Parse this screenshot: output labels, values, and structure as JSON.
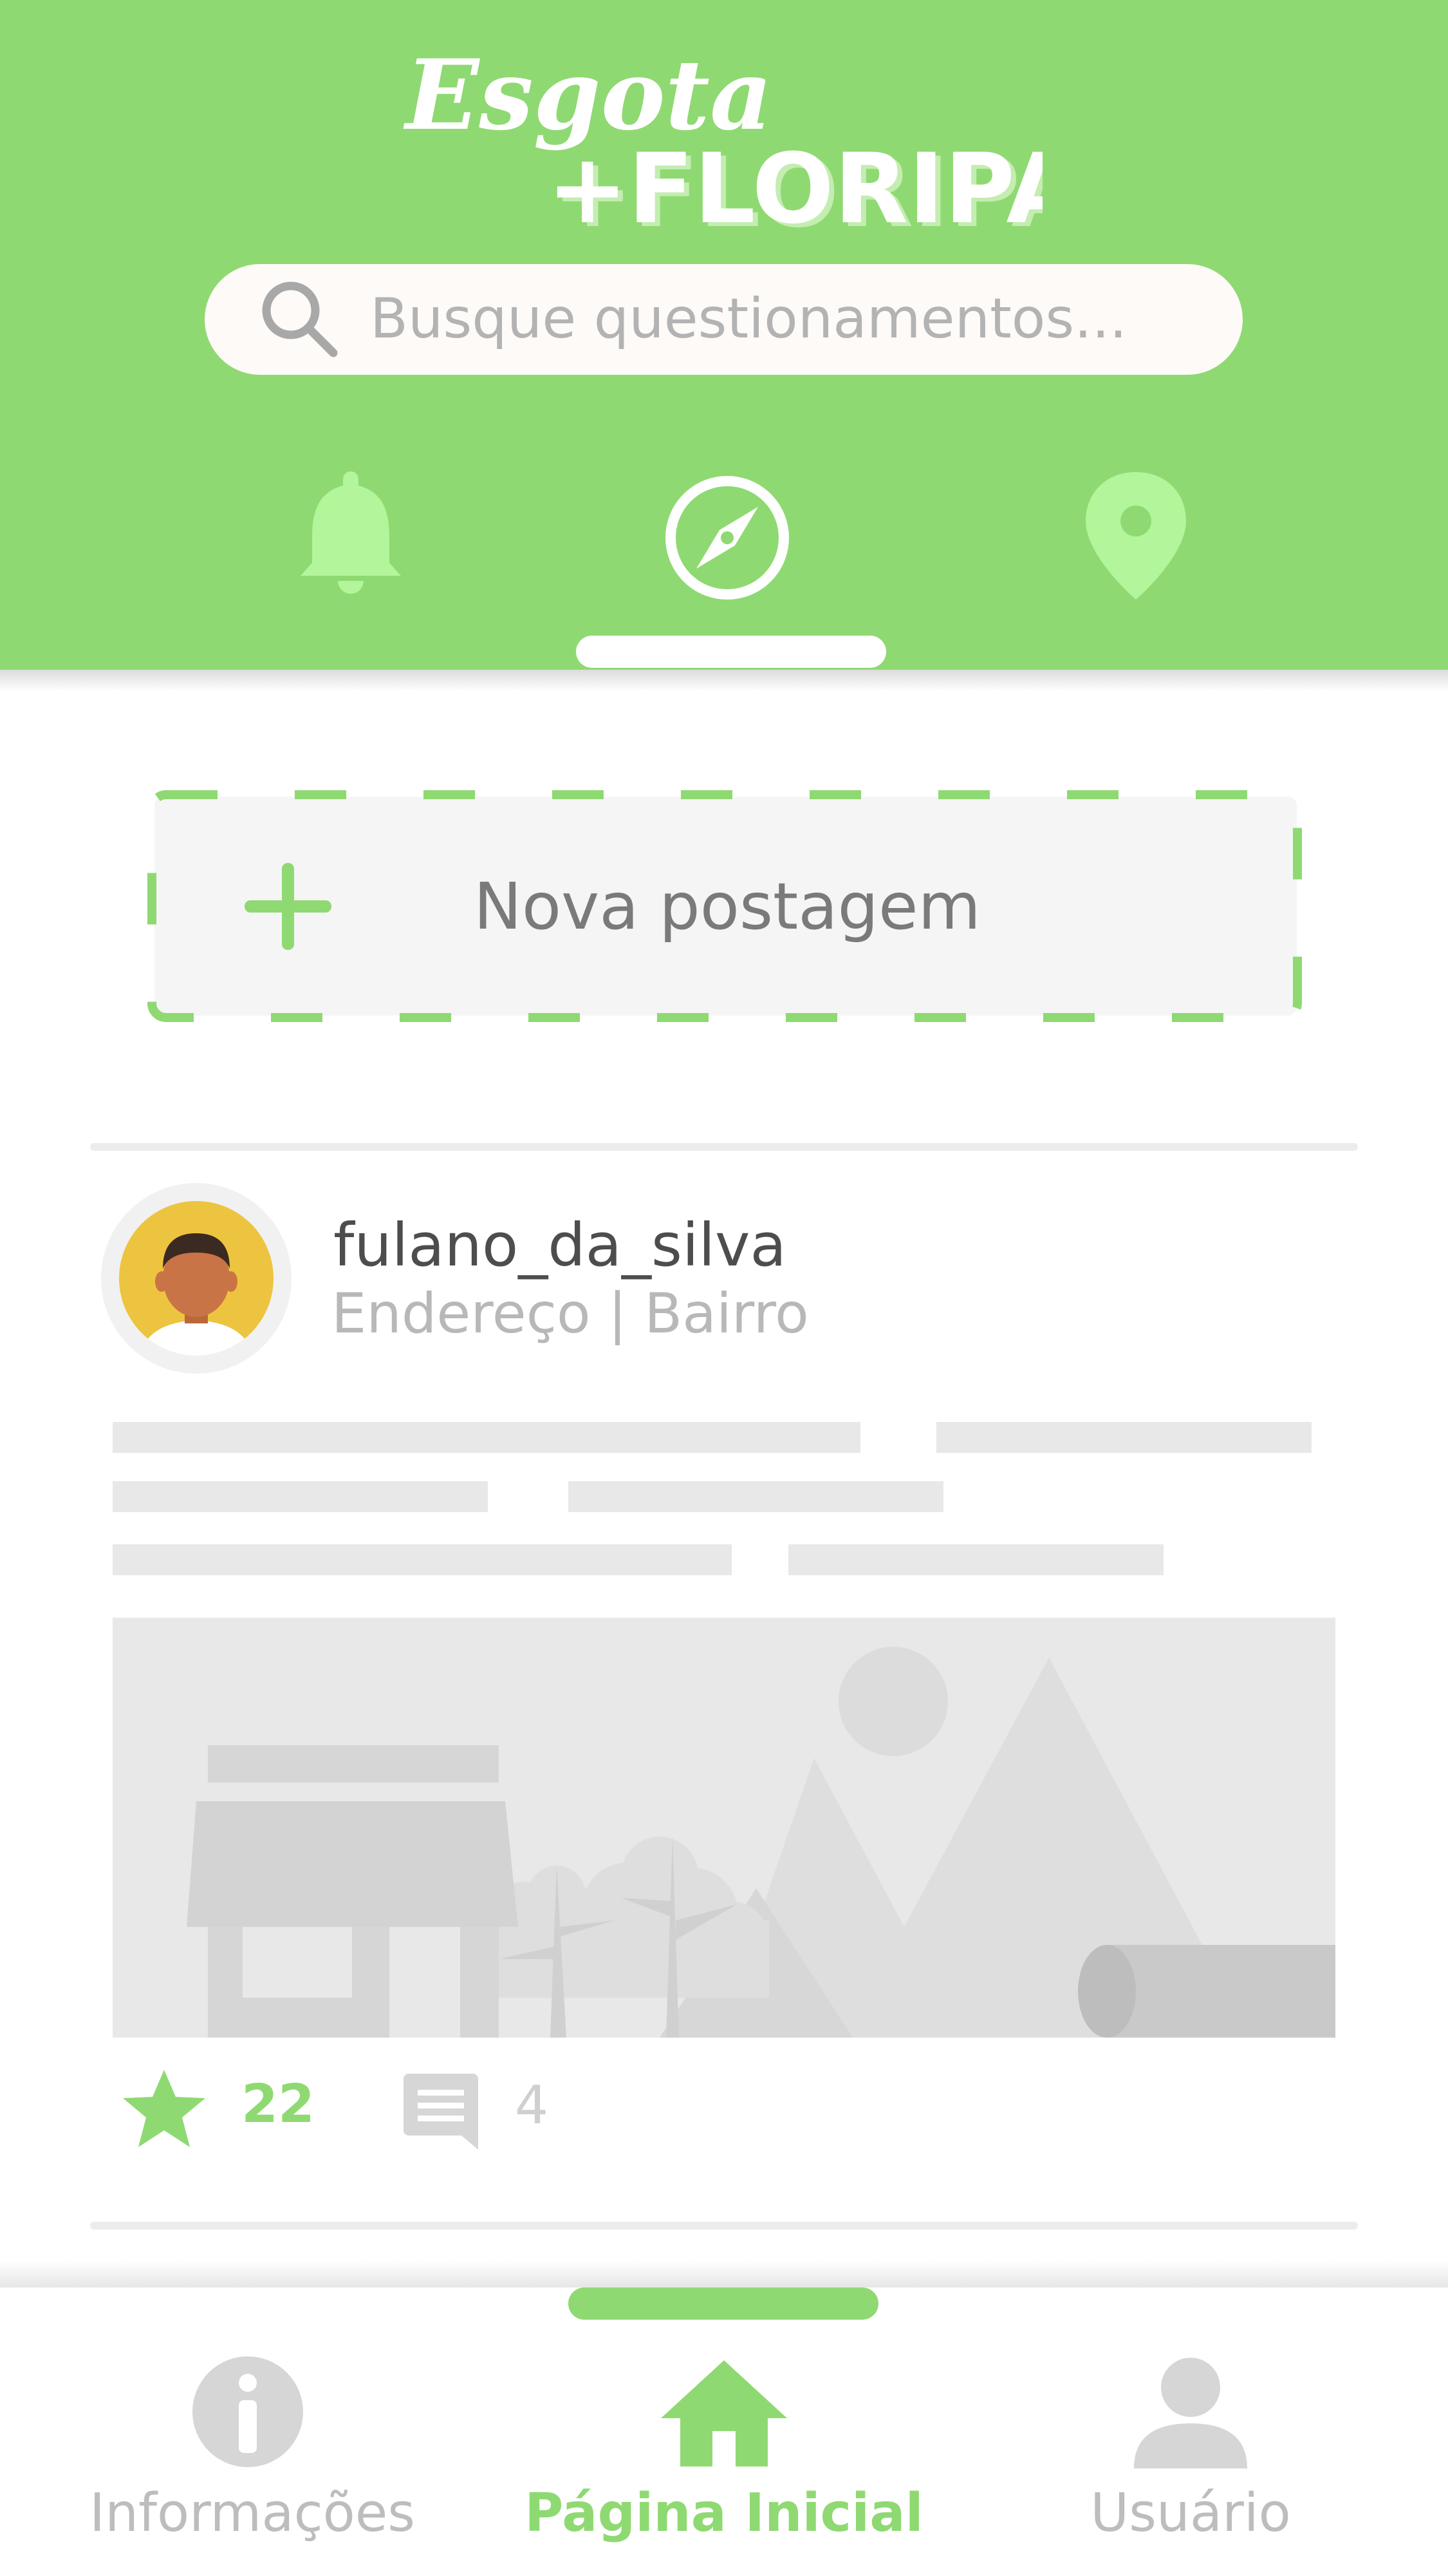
{
  "app": {
    "logo_line1": "Esgota",
    "logo_line2": "+FLORIPA"
  },
  "search": {
    "placeholder": "Busque questionamentos..."
  },
  "top_tabs": [
    {
      "icon": "bell-icon",
      "active": false
    },
    {
      "icon": "compass-icon",
      "active": true
    },
    {
      "icon": "location-pin-icon",
      "active": false
    }
  ],
  "new_post": {
    "label": "Nova postagem",
    "icon": "plus-icon"
  },
  "post": {
    "username": "fulano_da_silva",
    "location": "Endereço | Bairro",
    "likes": "22",
    "comments": "4"
  },
  "bottom_nav": {
    "items": [
      {
        "label": "Informações",
        "icon": "info-icon",
        "active": false
      },
      {
        "label": "Página Inicial",
        "icon": "home-icon",
        "active": true
      },
      {
        "label": "Usuário",
        "icon": "user-icon",
        "active": false
      }
    ]
  },
  "colors": {
    "accent": "#8fd972",
    "accent_light": "#b3f59a",
    "gray_text": "#b8b8b8"
  }
}
